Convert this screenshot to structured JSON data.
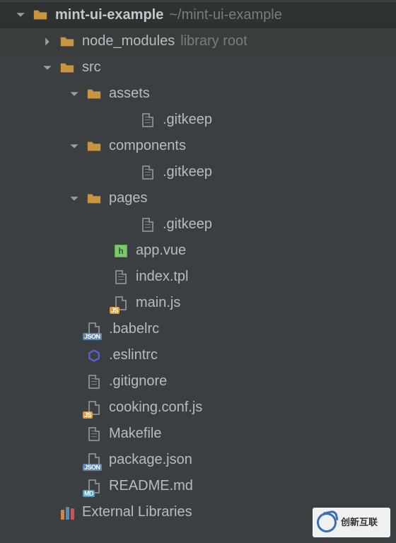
{
  "project": {
    "name": "mint-ui-example",
    "path": "~/mint-ui-example"
  },
  "tree": {
    "node_modules": {
      "label": "node_modules",
      "tag": "library root"
    },
    "src": {
      "label": "src",
      "assets": {
        "label": "assets",
        "gitkeep": ".gitkeep"
      },
      "components": {
        "label": "components",
        "gitkeep": ".gitkeep"
      },
      "pages": {
        "label": "pages",
        "gitkeep": ".gitkeep"
      },
      "app_vue": "app.vue",
      "index_tpl": "index.tpl",
      "main_js": "main.js"
    },
    "babelrc": ".babelrc",
    "eslintrc": ".eslintrc",
    "gitignore": ".gitignore",
    "cooking": "cooking.conf.js",
    "makefile": "Makefile",
    "package": "package.json",
    "readme": "README.md",
    "external": "External Libraries"
  },
  "watermark": "创新互联"
}
